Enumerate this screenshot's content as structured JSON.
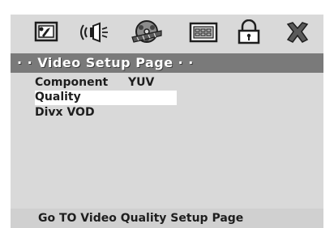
{
  "title": "· · Video Setup Page · ·",
  "icons": [
    {
      "name": "general-setup-icon"
    },
    {
      "name": "audio-setup-icon"
    },
    {
      "name": "video-setup-icon"
    },
    {
      "name": "preference-icon"
    },
    {
      "name": "password-lock-icon"
    },
    {
      "name": "exit-icon"
    }
  ],
  "menu": {
    "items": [
      {
        "label": "Component",
        "value": "YUV"
      },
      {
        "label": "Quality",
        "value": ""
      },
      {
        "label": "Divx VOD",
        "value": ""
      }
    ]
  },
  "footer": {
    "text": "Go TO Video Quality Setup Page"
  },
  "colors": {
    "screen_bg": "#d9d9d9",
    "title_bg": "#7a7a7a",
    "highlight": "#ffffff"
  }
}
